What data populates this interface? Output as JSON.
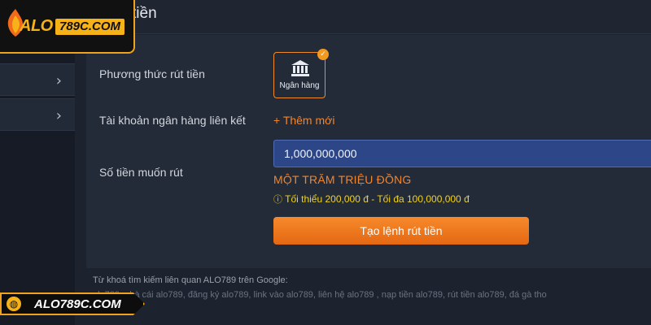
{
  "header": {
    "title": "tiền"
  },
  "sidebar": {
    "items": [
      {
        "chevron": "›"
      },
      {
        "chevron": "›"
      }
    ]
  },
  "form": {
    "method_label": "Phương thức rút tiền",
    "method_option": {
      "label": "Ngân hàng",
      "icon": "bank-icon",
      "selected": true
    },
    "linked_account_label": "Tài khoản ngân hàng liên kết",
    "add_new": "+ Thêm mới",
    "amount_label": "Số tiền muốn rút",
    "amount_value": "1,000,000,000",
    "amount_in_words": "MỘT TRĂM TRIỆU ĐỒNG",
    "limit_icon": "ⓘ",
    "limit_text": "Tối thiểu 200,000 đ - Tối đa 100,000,000 đ",
    "submit_label": "Tạo lệnh rút tiền"
  },
  "footer": {
    "keywords_title": "Từ khoá tìm kiếm liên quan ALO789 trên Google:",
    "keywords": "alo789, nhà cái alo789, đăng ký alo789, link vào alo789, liên hệ alo789 , nạp tiền alo789, rút tiền alo789, đá gà tho"
  },
  "logo_top": {
    "brand": "ALO",
    "brand_num": "789C.COM"
  },
  "logo_bottom": {
    "url": "ALO789C.COM"
  },
  "colors": {
    "accent": "#f3842a",
    "warning": "#f2d21c",
    "input_bg": "#2c4687",
    "panel": "#242b38"
  }
}
